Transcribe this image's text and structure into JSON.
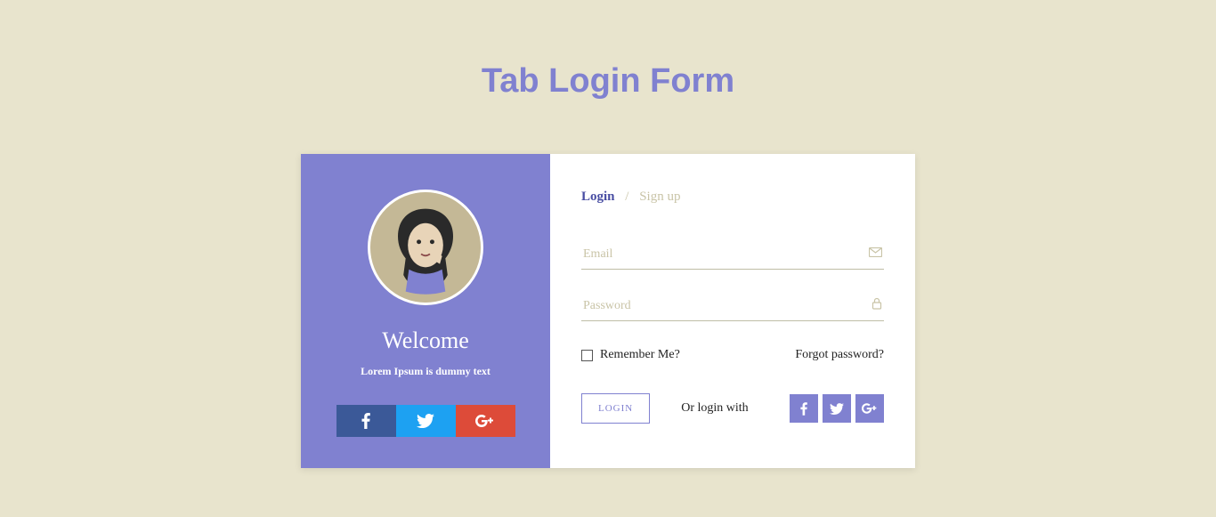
{
  "page_title": "Tab Login Form",
  "left": {
    "welcome": "Welcome",
    "subtitle": "Lorem Ipsum is dummy text"
  },
  "tabs": {
    "login": "Login",
    "separator": "/",
    "signup": "Sign up"
  },
  "inputs": {
    "email_placeholder": "Email",
    "password_placeholder": "Password"
  },
  "options": {
    "remember": "Remember Me?",
    "forgot": "Forgot password?"
  },
  "actions": {
    "login_btn": "LOGIN",
    "or_text": "Or login with"
  }
}
